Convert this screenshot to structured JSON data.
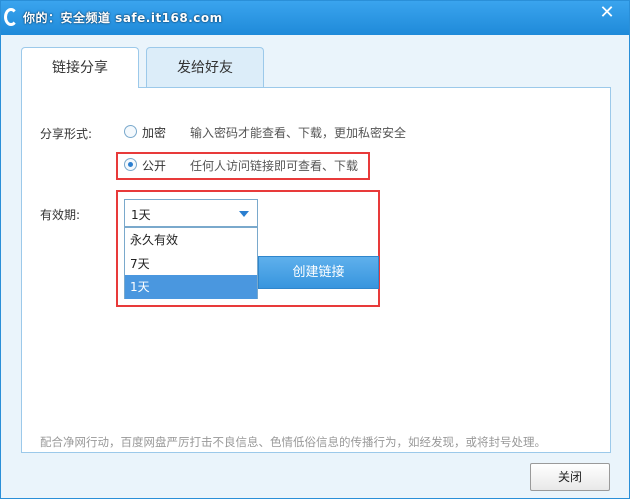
{
  "titlebar": {
    "watermark": "你的：安全频道 safe.it168.com",
    "close_symbol": "✕"
  },
  "tabs": [
    {
      "label": "链接分享",
      "active": true
    },
    {
      "label": "发给好友",
      "active": false
    }
  ],
  "share_form": {
    "label": "分享形式:",
    "options": [
      {
        "label": "加密",
        "hint": "输入密码才能查看、下载，更加私密安全",
        "checked": false
      },
      {
        "label": "公开",
        "hint": "任何人访问链接即可查看、下载",
        "checked": true
      }
    ]
  },
  "validity": {
    "label": "有效期:",
    "selected": "1天",
    "options": [
      "永久有效",
      "7天",
      "1天"
    ]
  },
  "create_button": "创建链接",
  "notice": "配合净网行动，百度网盘严厉打击不良信息、色情低俗信息的传播行为，如经发现，或将封号处理。",
  "footer": {
    "close_button": "关闭"
  },
  "colors": {
    "accent": "#2a8fd8",
    "highlight_box": "#e83a3a",
    "selected_option": "#4a97df"
  }
}
